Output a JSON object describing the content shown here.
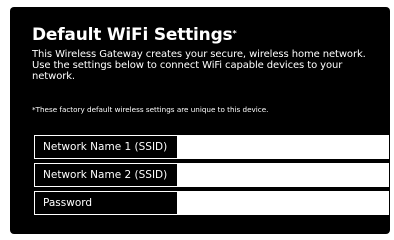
{
  "title": "Default WiFi Settings",
  "title_mark": "*",
  "description": "This Wireless Gateway creates your secure, wireless home network. Use the settings below to connect WiFi capable devices to your network.",
  "note": "*These factory default wireless settings are unique to this device.",
  "fields": [
    {
      "label": "Network Name 1 (SSID)",
      "value": ""
    },
    {
      "label": "Network Name 2 (SSID)",
      "value": ""
    },
    {
      "label": "Password",
      "value": ""
    }
  ],
  "colors": {
    "panel_background": "#000000",
    "text": "#ffffff",
    "field_background": "#ffffff"
  }
}
